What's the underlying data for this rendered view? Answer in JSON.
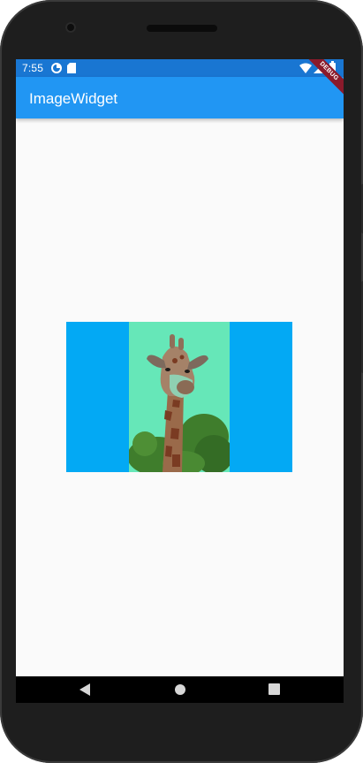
{
  "status_bar": {
    "time": "7:55",
    "icons": [
      "data-saver-icon",
      "sd-card-icon",
      "wifi-icon",
      "signal-icon",
      "battery-icon"
    ],
    "color": "#1976d2"
  },
  "app_bar": {
    "title": "ImageWidget",
    "color": "#2196f3"
  },
  "debug_banner": {
    "label": "DEBUG",
    "color": "#8b1a2b"
  },
  "content": {
    "image_box_color": "#03a9f4",
    "image_background_color": "#66e7b8",
    "image_subject": "giraffe-photo"
  },
  "nav_bar": {
    "buttons": [
      "back-icon",
      "home-icon",
      "recents-icon"
    ]
  }
}
